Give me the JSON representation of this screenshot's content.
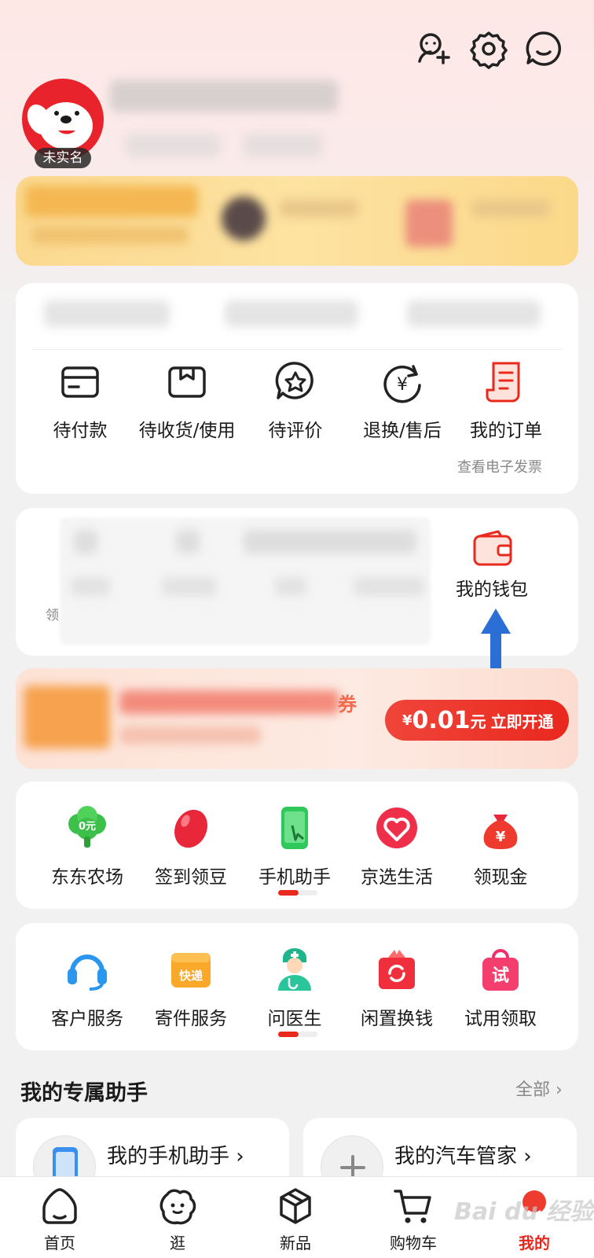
{
  "header": {
    "icons": [
      "add-friend-icon",
      "settings-icon",
      "message-icon"
    ]
  },
  "profile": {
    "badge": "未实名"
  },
  "orders": {
    "items": [
      {
        "label": "待付款",
        "icon": "wallet-card-icon"
      },
      {
        "label": "待收货/使用",
        "icon": "package-icon"
      },
      {
        "label": "待评价",
        "icon": "review-star-icon"
      },
      {
        "label": "退换/售后",
        "icon": "refund-yen-icon"
      },
      {
        "label": "我的订单",
        "icon": "order-list-icon"
      }
    ],
    "invoice_note": "查看电子发票"
  },
  "wallet": {
    "label": "我的钱包",
    "left_label": "领"
  },
  "promo": {
    "symbol": "¥",
    "amount": "0.01",
    "unit": "元",
    "cta": "立即开通",
    "trailing_char": "券"
  },
  "services_row1": [
    {
      "label": "东东农场",
      "icon": "farm-tree-icon",
      "badge": "0元"
    },
    {
      "label": "签到领豆",
      "icon": "jingdou-bean-icon"
    },
    {
      "label": "手机助手",
      "icon": "phone-assistant-icon"
    },
    {
      "label": "京选生活",
      "icon": "heart-life-icon"
    },
    {
      "label": "领现金",
      "icon": "money-bag-icon",
      "badge": "¥"
    }
  ],
  "services_row2": [
    {
      "label": "客户服务",
      "icon": "headset-icon"
    },
    {
      "label": "寄件服务",
      "icon": "express-box-icon",
      "badge": "快递"
    },
    {
      "label": "问医生",
      "icon": "doctor-icon"
    },
    {
      "label": "闲置换钱",
      "icon": "recycle-gift-icon"
    },
    {
      "label": "试用领取",
      "icon": "trial-bag-icon",
      "badge": "试"
    }
  ],
  "assistant_section": {
    "title": "我的专属助手",
    "all_link": "全部",
    "cards": [
      {
        "title": "我的手机助手"
      },
      {
        "title": "我的汽车管家"
      }
    ]
  },
  "tabbar": {
    "tabs": [
      {
        "label": "首页",
        "icon": "home-icon"
      },
      {
        "label": "逛",
        "icon": "browse-face-icon"
      },
      {
        "label": "新品",
        "icon": "new-cube-icon"
      },
      {
        "label": "购物车",
        "icon": "cart-icon"
      },
      {
        "label": "我的",
        "icon": "me-icon",
        "active": true
      }
    ]
  },
  "watermark": "Bai du 经验",
  "colors": {
    "brand_red": "#e9281e",
    "vip_gold": "#fbd98f",
    "arrow_blue": "#2b6fd6"
  }
}
